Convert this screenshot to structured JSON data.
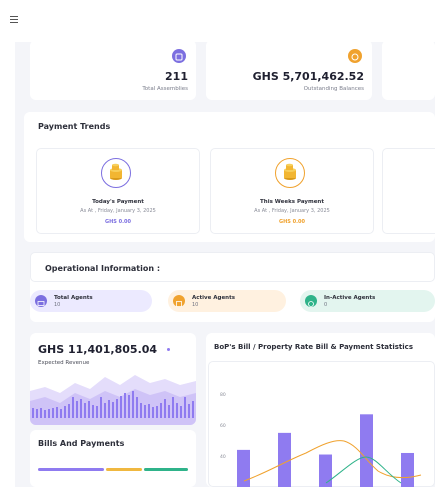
{
  "header": {
    "menu_icon": "hamburger-icon"
  },
  "stats": [
    {
      "value": "211",
      "label": "Total Assemblies",
      "icon": "assembly-icon",
      "color": "#7c6fe0"
    },
    {
      "value": "GHS 5,701,462.52",
      "label": "Outstanding Balances",
      "icon": "balance-icon",
      "color": "#f0a22e"
    }
  ],
  "payment_trends": {
    "title": "Payment Trends",
    "cards": [
      {
        "title": "Today's Payment",
        "date": "As At , Friday, January 3, 2025",
        "amount": "GHS 0.00",
        "amount_color": "#7c6fe0",
        "ring_color": "#7c6fe0"
      },
      {
        "title": "This Weeks Payment",
        "date": "As At , Friday, January 3, 2025",
        "amount": "GHS 0.00",
        "amount_color": "#f0a22e",
        "ring_color": "#f0a22e"
      }
    ]
  },
  "operational": {
    "title": "Operational Information :",
    "items": [
      {
        "label": "Total Agents",
        "count": "10",
        "bg": "#eceaff",
        "icon_bg": "#7c6fe0",
        "icon": "monitor-icon"
      },
      {
        "label": "Active Agents",
        "count": "10",
        "bg": "#fff1e0",
        "icon_bg": "#f0a22e",
        "icon": "calendar-icon"
      },
      {
        "label": "In-Active Agents",
        "count": "0",
        "bg": "#e3f5ef",
        "icon_bg": "#2fb38a",
        "icon": "chat-icon"
      }
    ]
  },
  "revenue": {
    "value": "GHS 11,401,805.04",
    "label": "Expected Revenue"
  },
  "bills": {
    "title": "Bills And Payments"
  },
  "statistics": {
    "title": "BoP's Bill / Property Rate Bill & Payment Statistics"
  },
  "chart_data": {
    "type": "bar",
    "title": "BoP's Bill / Property Rate Bill & Payment Statistics",
    "yticks": [
      "80",
      "60",
      "40"
    ],
    "ylim": [
      20,
      95
    ],
    "values": [
      44,
      55,
      41,
      67,
      42
    ],
    "bar_color": "#8f7bf0",
    "lines": [
      {
        "color": "#f0a22e"
      },
      {
        "color": "#2fb38a"
      }
    ]
  }
}
